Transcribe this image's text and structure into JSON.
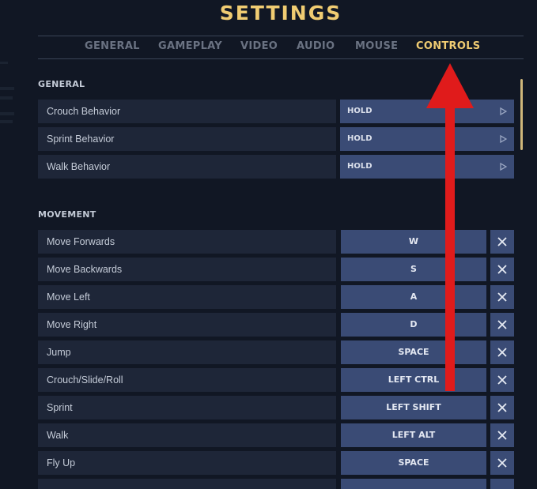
{
  "title": "SETTINGS",
  "tabs": [
    {
      "label": "GENERAL",
      "active": false
    },
    {
      "label": "GAMEPLAY",
      "active": false
    },
    {
      "label": "VIDEO",
      "active": false
    },
    {
      "label": "AUDIO",
      "active": false
    },
    {
      "label": "MOUSE",
      "active": false
    },
    {
      "label": "CONTROLS",
      "active": true
    }
  ],
  "sections": {
    "general": {
      "heading": "GENERAL",
      "rows": [
        {
          "label": "Crouch Behavior",
          "value": "HOLD"
        },
        {
          "label": "Sprint Behavior",
          "value": "HOLD"
        },
        {
          "label": "Walk Behavior",
          "value": "HOLD"
        }
      ]
    },
    "movement": {
      "heading": "MOVEMENT",
      "rows": [
        {
          "label": "Move Forwards",
          "key": "W"
        },
        {
          "label": "Move Backwards",
          "key": "S"
        },
        {
          "label": "Move Left",
          "key": "A"
        },
        {
          "label": "Move Right",
          "key": "D"
        },
        {
          "label": "Jump",
          "key": "SPACE"
        },
        {
          "label": "Crouch/Slide/Roll",
          "key": "LEFT CTRL"
        },
        {
          "label": "Sprint",
          "key": "LEFT SHIFT"
        },
        {
          "label": "Walk",
          "key": "LEFT ALT"
        },
        {
          "label": "Fly Up",
          "key": "SPACE"
        }
      ]
    }
  },
  "colors": {
    "accent": "#f0cc72",
    "background": "#111724",
    "row_label_bg": "#1e2638",
    "value_bg": "#3a4b75",
    "annotation_arrow": "#e01b1b"
  },
  "icons": {
    "option_arrow": "play-triangle-icon",
    "clear_binding": "close-icon",
    "annotation": "red-up-arrow-icon"
  }
}
